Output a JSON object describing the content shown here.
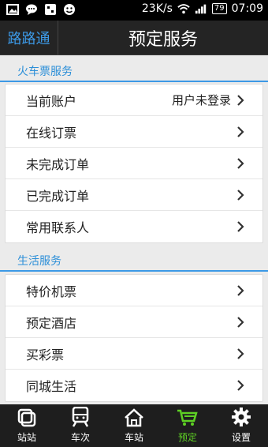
{
  "status_bar": {
    "speed": "23K/s",
    "battery": "79",
    "time": "07:09"
  },
  "header": {
    "brand": "路路通",
    "title": "预定服务"
  },
  "sections": [
    {
      "title": "火车票服务",
      "items": [
        {
          "label": "当前账户",
          "value": "用户未登录"
        },
        {
          "label": "在线订票"
        },
        {
          "label": "未完成订单"
        },
        {
          "label": "已完成订单"
        },
        {
          "label": "常用联系人"
        }
      ]
    },
    {
      "title": "生活服务",
      "items": [
        {
          "label": "特价机票"
        },
        {
          "label": "预定酒店"
        },
        {
          "label": "买彩票"
        },
        {
          "label": "同城生活"
        }
      ]
    }
  ],
  "tabs": [
    {
      "label": "站站",
      "icon": "station-to-station-icon"
    },
    {
      "label": "车次",
      "icon": "train-icon"
    },
    {
      "label": "车站",
      "icon": "house-icon"
    },
    {
      "label": "预定",
      "icon": "cart-icon",
      "active": true
    },
    {
      "label": "设置",
      "icon": "gear-icon"
    }
  ],
  "colors": {
    "accent": "#3c99e6",
    "active_tab": "#5ed024"
  }
}
